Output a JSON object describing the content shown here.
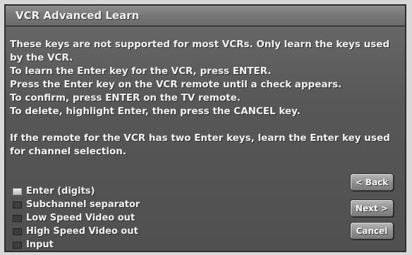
{
  "window": {
    "title": "VCR Advanced Learn"
  },
  "instructions": [
    "These keys are not supported for most VCRs. Only learn the keys used",
    "by the VCR.",
    "To learn the Enter key for the VCR, press ENTER.",
    "Press the Enter key on the VCR remote until a check appears.",
    "To confirm, press ENTER on the TV remote.",
    "To delete, highlight Enter, then press the CANCEL key.",
    "",
    "If the remote for the VCR has two Enter keys, learn the Enter key used",
    "for channel selection."
  ],
  "keys": [
    {
      "label": "Enter (digits)",
      "active": true
    },
    {
      "label": "Subchannel separator",
      "active": false
    },
    {
      "label": "Low Speed Video out",
      "active": false
    },
    {
      "label": "High Speed Video out",
      "active": false
    },
    {
      "label": "Input",
      "active": false
    }
  ],
  "buttons": {
    "back": "< Back",
    "next": "Next >",
    "cancel": "Cancel"
  }
}
